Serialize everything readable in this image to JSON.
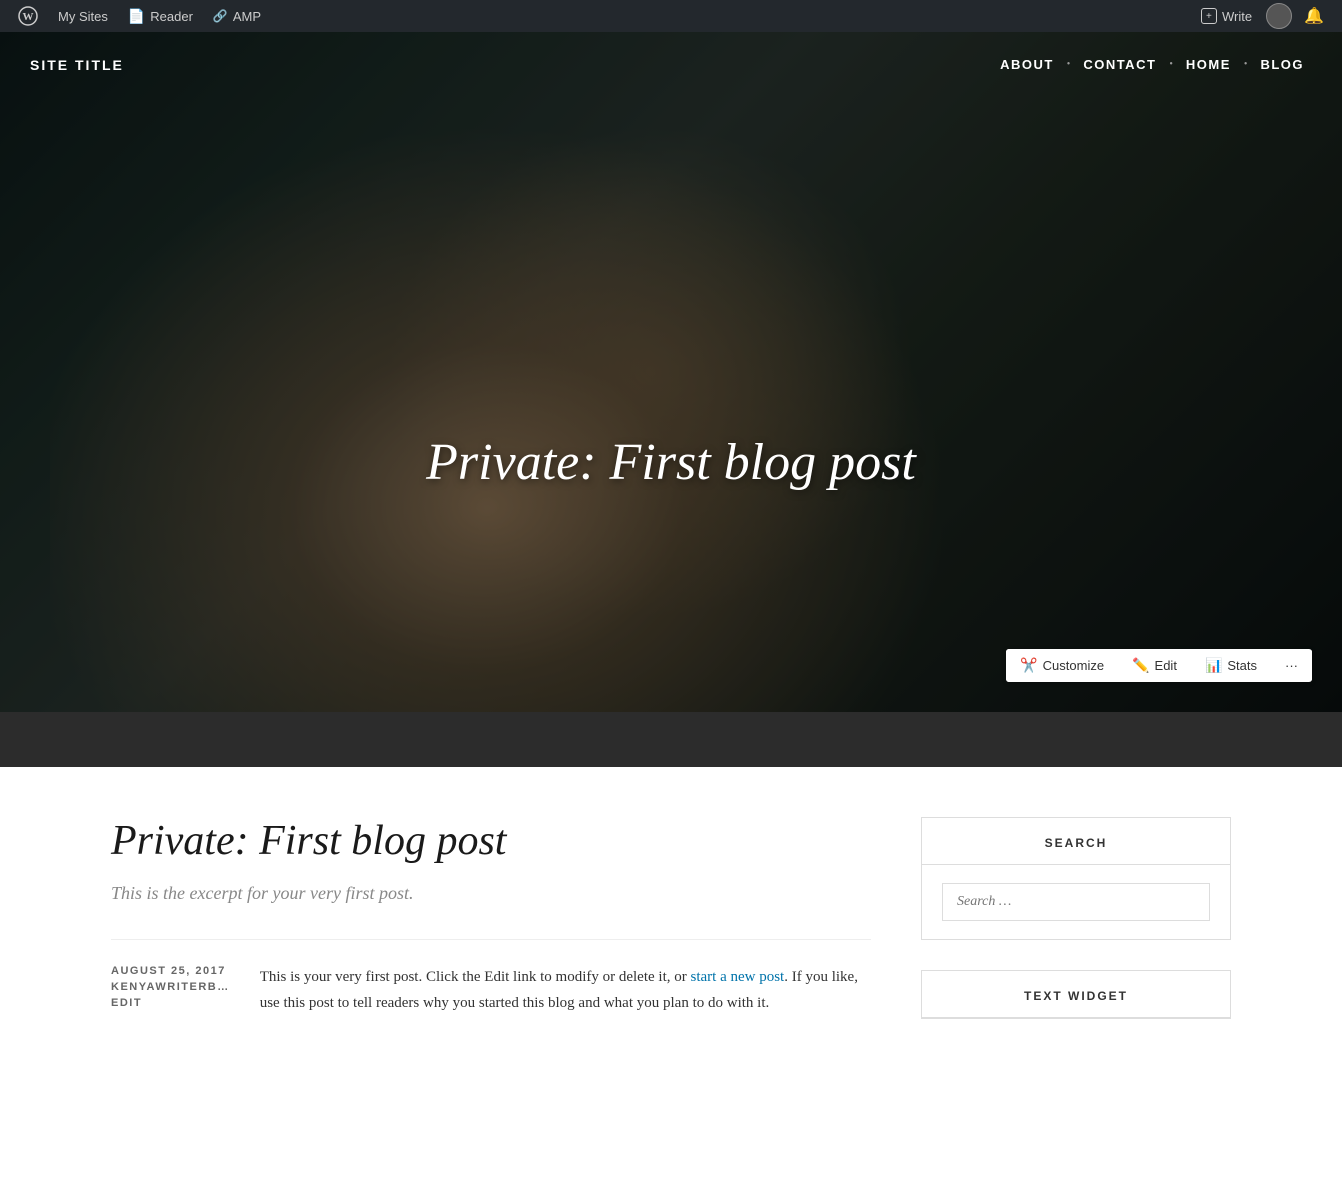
{
  "admin_bar": {
    "wp_icon": "W",
    "my_sites_label": "My Sites",
    "reader_label": "Reader",
    "amp_label": "AMP",
    "write_label": "Write",
    "bell_label": "Notifications"
  },
  "header": {
    "site_title": "SITE TITLE",
    "nav": [
      {
        "label": "ABOUT",
        "id": "about"
      },
      {
        "label": "CONTACT",
        "id": "contact"
      },
      {
        "label": "HOME",
        "id": "home"
      },
      {
        "label": "BLOG",
        "id": "blog"
      }
    ]
  },
  "hero": {
    "title": "Private: First blog post"
  },
  "toolbar": {
    "customize_label": "Customize",
    "edit_label": "Edit",
    "stats_label": "Stats",
    "more_label": "···"
  },
  "post": {
    "title": "Private: First blog post",
    "excerpt": "This is the excerpt for your very first post.",
    "date": "AUGUST 25, 2017",
    "author": "KENYAWRITERB…",
    "edit_label": "EDIT",
    "body_part1": "This is your very first post. Click the Edit link to modify or delete it, or ",
    "body_link_text": "start a new post",
    "body_part2": ". If you like, use this post to tell readers why you started this blog and what you plan to do with it."
  },
  "sidebar": {
    "search_widget_title": "SEARCH",
    "search_placeholder": "Search …",
    "text_widget_title": "TEXT WIDGET"
  }
}
